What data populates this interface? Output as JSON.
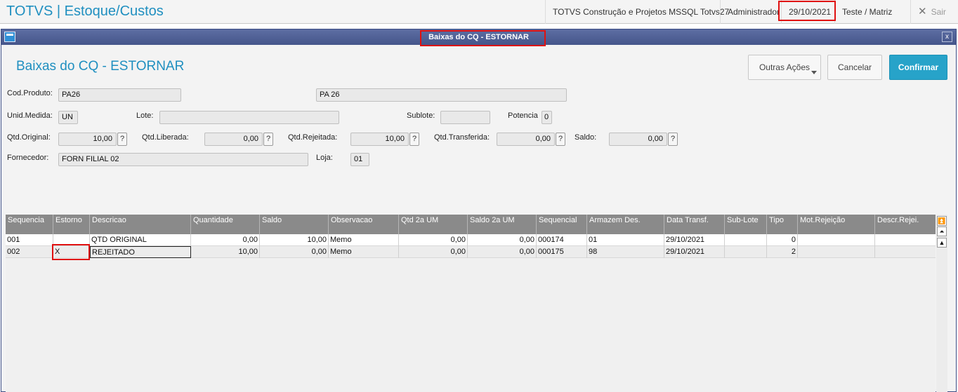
{
  "app": {
    "title": "TOTVS | Estoque/Custos",
    "environment": "TOTVS Construção e Projetos MSSQL Totvs27",
    "user": "Administrador",
    "date": "29/10/2021",
    "branch": "Teste / Matriz",
    "exit_label": "Sair"
  },
  "window": {
    "title": "Baixas do CQ - ESTORNAR",
    "close_glyph": "x"
  },
  "page": {
    "title": "Baixas do CQ - ESTORNAR",
    "actions": {
      "other": "Outras Ações",
      "cancel": "Cancelar",
      "confirm": "Confirmar"
    }
  },
  "form": {
    "cod_produto": {
      "label": "Cod.Produto:",
      "value": "PA26",
      "description": "PA 26"
    },
    "unid_medida": {
      "label": "Unid.Medida:",
      "value": "UN"
    },
    "lote": {
      "label": "Lote:",
      "value": ""
    },
    "sublote": {
      "label": "Sublote:",
      "value": ""
    },
    "potencia": {
      "label": "Potencia",
      "value": "0"
    },
    "qtd_original": {
      "label": "Qtd.Original:",
      "value": "10,00"
    },
    "qtd_liberada": {
      "label": "Qtd.Liberada:",
      "value": "0,00"
    },
    "qtd_rejeitada": {
      "label": "Qtd.Rejeitada:",
      "value": "10,00"
    },
    "qtd_transferida": {
      "label": "Qtd.Transferida:",
      "value": "0,00"
    },
    "saldo": {
      "label": "Saldo:",
      "value": "0,00"
    },
    "fornecedor": {
      "label": "Fornecedor:",
      "value": "FORN FILIAL 02"
    },
    "loja": {
      "label": "Loja:",
      "value": "01"
    },
    "help_glyph": "?"
  },
  "grid": {
    "columns": [
      "Sequencia",
      "Estorno",
      "Descricao",
      "Quantidade",
      "Saldo",
      "Observacao",
      "Qtd 2a UM",
      "Saldo 2a UM",
      "Sequencial",
      "Armazem Des.",
      "Data Transf.",
      "Sub-Lote",
      "Tipo",
      "Mot.Rejeição",
      "Descr.Rejei."
    ],
    "rows": [
      [
        "001",
        "",
        "QTD ORIGINAL",
        "0,00",
        "10,00",
        "Memo",
        "0,00",
        "0,00",
        "000174",
        "01",
        "29/10/2021",
        "",
        "0",
        "",
        ""
      ],
      [
        "002",
        "X",
        "REJEITADO",
        "10,00",
        "0,00",
        "Memo",
        "0,00",
        "0,00",
        "000175",
        "98",
        "29/10/2021",
        "",
        "2",
        "",
        ""
      ]
    ],
    "scroll": {
      "top": "⏫",
      "page_up": "⏶",
      "up": "▲"
    }
  }
}
